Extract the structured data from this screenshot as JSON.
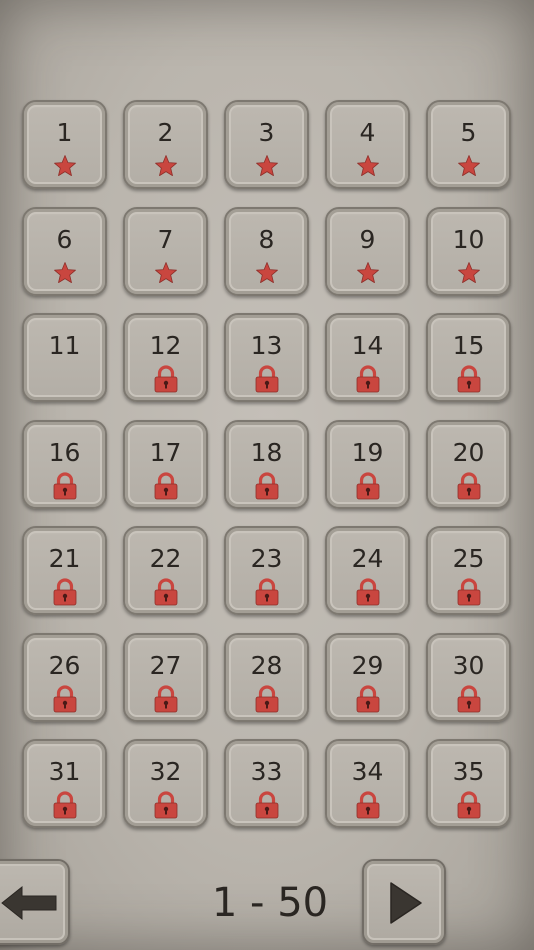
{
  "colors": {
    "accent": "#c9463f",
    "text": "#2a2622",
    "tile_bg": "#b8b3ab",
    "background": "#bab5ad"
  },
  "levels": [
    {
      "number": "1",
      "status": "star"
    },
    {
      "number": "2",
      "status": "star"
    },
    {
      "number": "3",
      "status": "star"
    },
    {
      "number": "4",
      "status": "star"
    },
    {
      "number": "5",
      "status": "star"
    },
    {
      "number": "6",
      "status": "star"
    },
    {
      "number": "7",
      "status": "star"
    },
    {
      "number": "8",
      "status": "star"
    },
    {
      "number": "9",
      "status": "star"
    },
    {
      "number": "10",
      "status": "star"
    },
    {
      "number": "11",
      "status": "open"
    },
    {
      "number": "12",
      "status": "locked"
    },
    {
      "number": "13",
      "status": "locked"
    },
    {
      "number": "14",
      "status": "locked"
    },
    {
      "number": "15",
      "status": "locked"
    },
    {
      "number": "16",
      "status": "locked"
    },
    {
      "number": "17",
      "status": "locked"
    },
    {
      "number": "18",
      "status": "locked"
    },
    {
      "number": "19",
      "status": "locked"
    },
    {
      "number": "20",
      "status": "locked"
    },
    {
      "number": "21",
      "status": "locked"
    },
    {
      "number": "22",
      "status": "locked"
    },
    {
      "number": "23",
      "status": "locked"
    },
    {
      "number": "24",
      "status": "locked"
    },
    {
      "number": "25",
      "status": "locked"
    },
    {
      "number": "26",
      "status": "locked"
    },
    {
      "number": "27",
      "status": "locked"
    },
    {
      "number": "28",
      "status": "locked"
    },
    {
      "number": "29",
      "status": "locked"
    },
    {
      "number": "30",
      "status": "locked"
    },
    {
      "number": "31",
      "status": "locked"
    },
    {
      "number": "32",
      "status": "locked"
    },
    {
      "number": "33",
      "status": "locked"
    },
    {
      "number": "34",
      "status": "locked"
    },
    {
      "number": "35",
      "status": "locked"
    }
  ],
  "nav": {
    "page_range": "1 - 50",
    "back_icon": "arrow-left-icon",
    "next_icon": "play-right-icon"
  }
}
